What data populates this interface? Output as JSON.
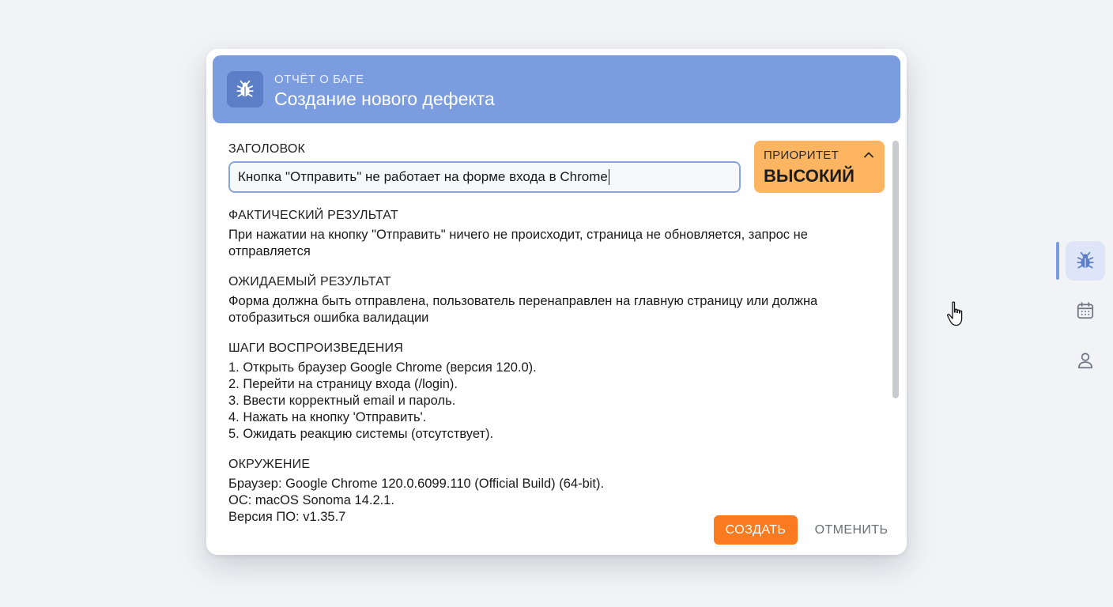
{
  "dialog": {
    "eyebrow": "ОТЧЁТ О БАГЕ",
    "title": "Создание нового дефекта",
    "header_icon": "bug-icon"
  },
  "form": {
    "title_label": "ЗАГОЛОВОК",
    "title_value": "Кнопка \"Отправить\" не работает на форме входа в Chrome",
    "priority": {
      "label": "ПРИОРИТЕТ",
      "value": "ВЫСОКИЙ",
      "icon": "chevron-up-icon",
      "color": "#fdb561"
    },
    "actual": {
      "label": "ФАКТИЧЕСКИЙ РЕЗУЛЬТАТ",
      "lines": [
        "При нажатии на кнопку \"Отправить\" ничего не происходит, страница не обновляется, запрос не",
        "отправляется"
      ]
    },
    "expected": {
      "label": "ОЖИДАЕМЫЙ РЕЗУЛЬТАТ",
      "lines": [
        "Форма должна быть отправлена, пользователь перенаправлен на главную страницу или должна",
        "отобразиться ошибка валидации"
      ]
    },
    "steps": {
      "label": "ШАГИ ВОСПРОИЗВЕДЕНИЯ",
      "items": [
        "1. Открыть браузер Google Chrome (версия 120.0).",
        "2. Перейти на страницу входа (/login).",
        "3. Ввести корректный email и пароль.",
        "4. Нажать на кнопку 'Отправить'.",
        "5. Ожидать реакцию системы (отсутствует)."
      ]
    },
    "environment": {
      "label": "ОКРУЖЕНИЕ",
      "lines": [
        "Браузер: Google Chrome 120.0.6099.110 (Official Build) (64-bit).",
        "ОС: macOS Sonoma 14.2.1.",
        "Версия ПО: v1.35.7"
      ]
    }
  },
  "actions": {
    "create_label": "СОЗДАТЬ",
    "cancel_label": "ОТМЕНИТЬ",
    "accent": "#f97a1f"
  },
  "side_rail": {
    "items": [
      {
        "icon": "bug-icon",
        "active": true
      },
      {
        "icon": "calendar-icon",
        "active": false
      },
      {
        "icon": "user-icon",
        "active": false
      }
    ]
  }
}
